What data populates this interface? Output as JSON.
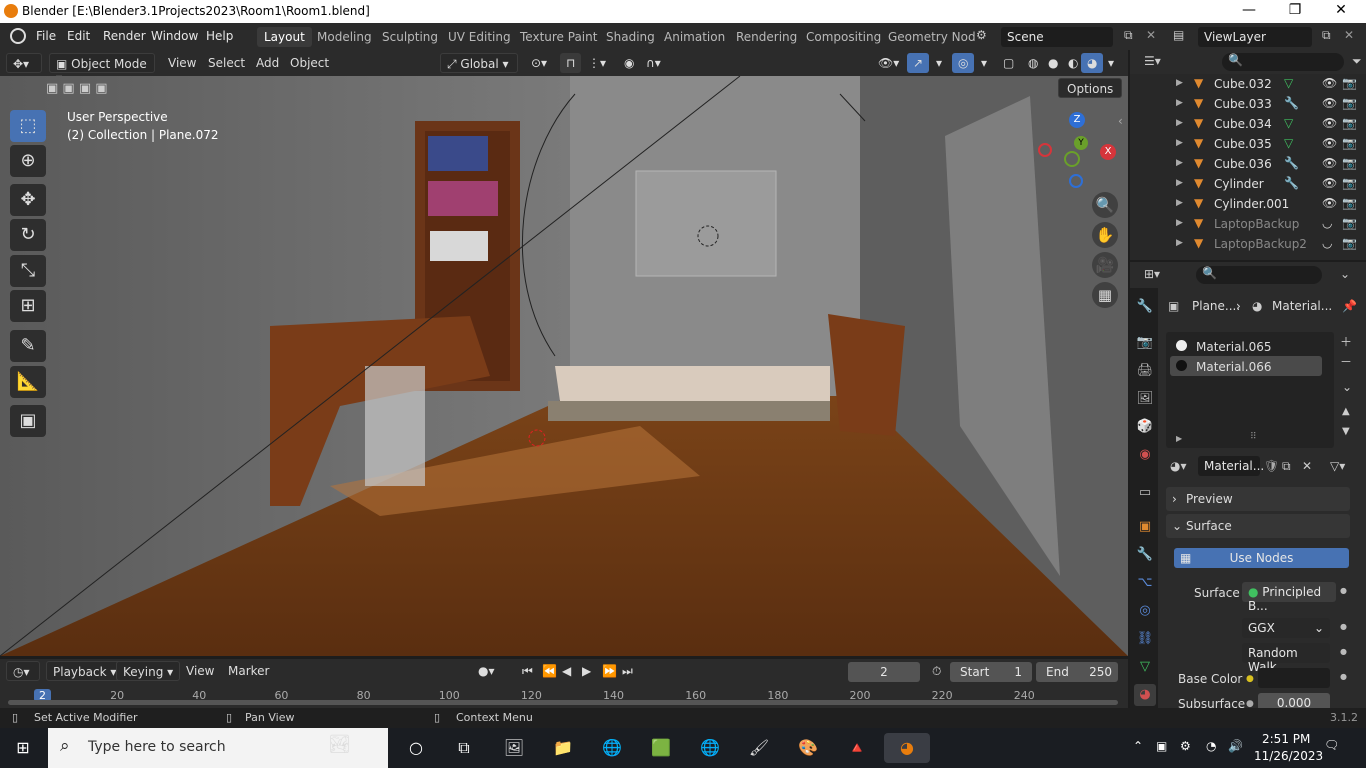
{
  "window": {
    "title": "Blender [E:\\Blender3.1Projects2023\\Room1\\Room1.blend]",
    "minimize": "—",
    "maximize": "❐",
    "close": "✕"
  },
  "menus": [
    "File",
    "Edit",
    "Render",
    "Window",
    "Help"
  ],
  "workspaces": [
    "Layout",
    "Modeling",
    "Sculpting",
    "UV Editing",
    "Texture Paint",
    "Shading",
    "Animation",
    "Rendering",
    "Compositing",
    "Geometry Nod"
  ],
  "scene": "Scene",
  "view_layer": "ViewLayer",
  "viewport_header": {
    "mode": "Object Mode",
    "menus": [
      "View",
      "Select",
      "Add",
      "Object"
    ],
    "orientation": "Global",
    "options": "Options"
  },
  "viewport": {
    "perspective": "User Perspective",
    "collection": "(2) Collection | Plane.072"
  },
  "gizmo": {
    "z": "Z",
    "y": "Y",
    "x": "X"
  },
  "outliner": {
    "items": [
      {
        "name": "Cube.032",
        "mod": "mesh",
        "dim": false
      },
      {
        "name": "Cube.033",
        "mod": "wrench",
        "dim": false
      },
      {
        "name": "Cube.034",
        "mod": "mesh",
        "dim": false
      },
      {
        "name": "Cube.035",
        "mod": "mesh",
        "dim": false
      },
      {
        "name": "Cube.036",
        "mod": "wrench",
        "dim": false
      },
      {
        "name": "Cylinder",
        "mod": "wrench",
        "dim": false
      },
      {
        "name": "Cylinder.001",
        "mod": "",
        "dim": false
      },
      {
        "name": "LaptopBackup",
        "mod": "",
        "dim": true
      },
      {
        "name": "LaptopBackup2",
        "mod": "",
        "dim": true
      }
    ]
  },
  "properties": {
    "breadcrumb_object": "Plane....",
    "breadcrumb_material": "Material...",
    "slots": [
      "Material.065",
      "Material.066"
    ],
    "selected_slot": 1,
    "material_name": "Material...",
    "preview": "Preview",
    "surface_panel": "Surface",
    "use_nodes": "Use Nodes",
    "surface_label": "Surface",
    "surface_value": "Principled B...",
    "distribution": "GGX",
    "subsurface_method": "Random Walk",
    "base_color_label": "Base Color",
    "subsurface_label": "Subsurface",
    "subsurface_value": "0.000"
  },
  "timeline": {
    "playback": "Playback",
    "keying": "Keying",
    "view": "View",
    "marker": "Marker",
    "current_frame": "2",
    "start_label": "Start",
    "start": "1",
    "end_label": "End",
    "end": "250",
    "ruler": [
      "2",
      "20",
      "40",
      "60",
      "80",
      "100",
      "120",
      "140",
      "160",
      "180",
      "200",
      "220",
      "240"
    ]
  },
  "statusbar": {
    "left": "Set Active Modifier",
    "middle": "Pan View",
    "right": "Context Menu",
    "version": "3.1.2"
  },
  "taskbar": {
    "search_placeholder": "Type here to search",
    "time": "2:51 PM",
    "date": "11/26/2023"
  },
  "colors": {
    "accent": "#4772b3",
    "header": "#2b2b2b",
    "floor": "#8a4a1c",
    "wall": "#6e6e6e"
  }
}
